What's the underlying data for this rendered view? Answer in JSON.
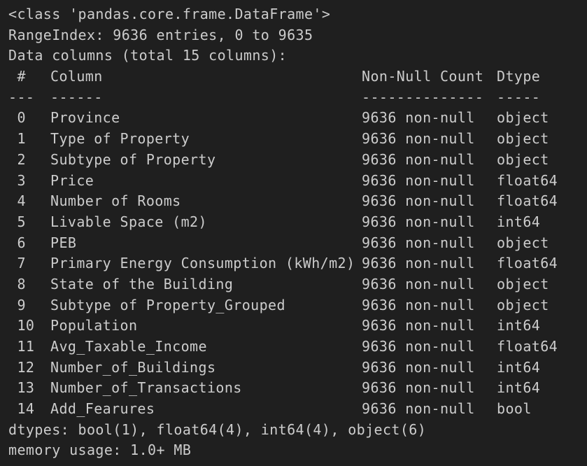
{
  "info": {
    "class_line": "<class 'pandas.core.frame.DataFrame'>",
    "range_index": "RangeIndex: 9636 entries, 0 to 9635",
    "data_columns": "Data columns (total 15 columns):",
    "header": {
      "idx": " #",
      "column": "Column",
      "non_null": "Non-Null Count",
      "dtype": "Dtype"
    },
    "separator": {
      "idx": "---",
      "column": "------",
      "non_null": "--------------",
      "dtype": "-----"
    },
    "rows": [
      {
        "idx": " 0",
        "column": "Province",
        "non_null": "9636 non-null",
        "dtype": "object"
      },
      {
        "idx": " 1",
        "column": "Type of Property",
        "non_null": "9636 non-null",
        "dtype": "object"
      },
      {
        "idx": " 2",
        "column": "Subtype of Property",
        "non_null": "9636 non-null",
        "dtype": "object"
      },
      {
        "idx": " 3",
        "column": "Price",
        "non_null": "9636 non-null",
        "dtype": "float64"
      },
      {
        "idx": " 4",
        "column": "Number of Rooms",
        "non_null": "9636 non-null",
        "dtype": "float64"
      },
      {
        "idx": " 5",
        "column": "Livable Space (m2)",
        "non_null": "9636 non-null",
        "dtype": "int64"
      },
      {
        "idx": " 6",
        "column": "PEB",
        "non_null": "9636 non-null",
        "dtype": "object"
      },
      {
        "idx": " 7",
        "column": "Primary Energy Consumption (kWh/m2)",
        "non_null": "9636 non-null",
        "dtype": "float64"
      },
      {
        "idx": " 8",
        "column": "State of the Building",
        "non_null": "9636 non-null",
        "dtype": "object"
      },
      {
        "idx": " 9",
        "column": "Subtype of Property_Grouped",
        "non_null": "9636 non-null",
        "dtype": "object"
      },
      {
        "idx": " 10",
        "column": "Population",
        "non_null": "9636 non-null",
        "dtype": "int64"
      },
      {
        "idx": " 11",
        "column": "Avg_Taxable_Income",
        "non_null": "9636 non-null",
        "dtype": "float64"
      },
      {
        "idx": " 12",
        "column": "Number_of_Buildings",
        "non_null": "9636 non-null",
        "dtype": "int64"
      },
      {
        "idx": " 13",
        "column": "Number_of_Transactions",
        "non_null": "9636 non-null",
        "dtype": "int64"
      },
      {
        "idx": " 14",
        "column": "Add_Fearures",
        "non_null": "9636 non-null",
        "dtype": "bool"
      }
    ],
    "dtypes_line": "dtypes: bool(1), float64(4), int64(4), object(6)",
    "memory_line": "memory usage: 1.0+ MB"
  },
  "colors": {
    "background": "#1f1f1f",
    "text": "#cccccc"
  }
}
